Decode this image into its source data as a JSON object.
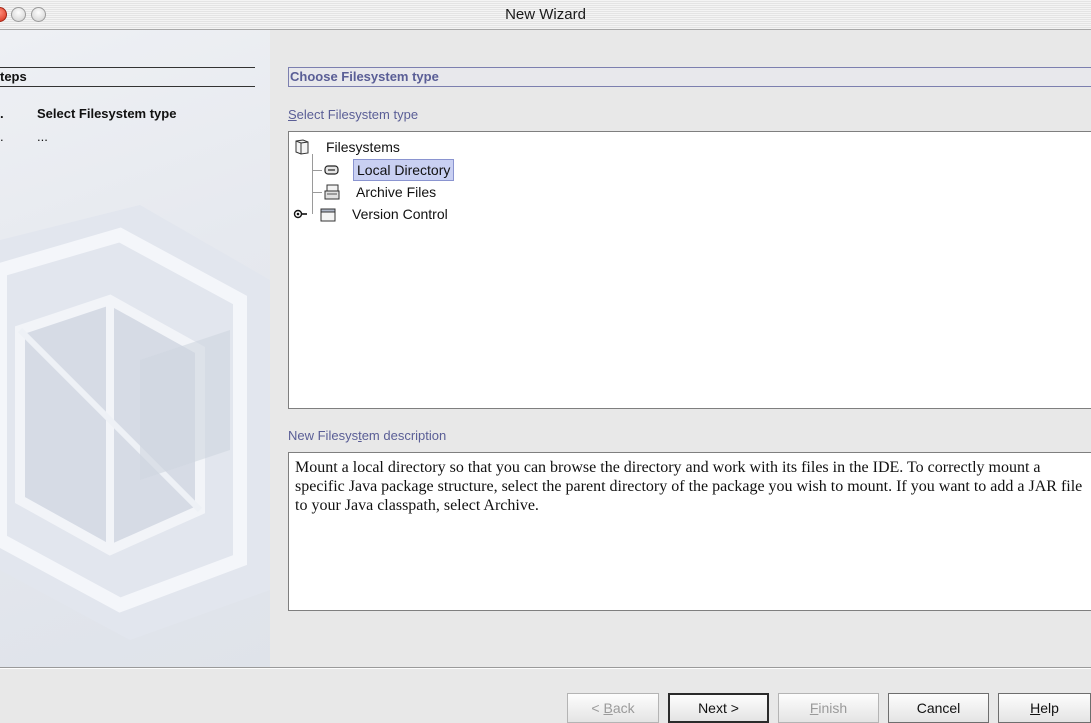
{
  "window": {
    "title": "New Wizard"
  },
  "steps": {
    "heading": "teps",
    "items": [
      {
        "num": ".",
        "label": "Select Filesystem type",
        "current": true
      },
      {
        "num": ".",
        "label": "...",
        "current": false
      }
    ]
  },
  "main": {
    "panel_title": "Choose Filesystem type",
    "tree_label_prefix": "",
    "tree_label_mnemonic": "S",
    "tree_label_rest": "elect Filesystem type",
    "tree": {
      "root": "Filesystems",
      "items": [
        {
          "label": "Local Directory",
          "icon": "drive-icon",
          "selected": true
        },
        {
          "label": "Archive Files",
          "icon": "archive-icon",
          "selected": false
        },
        {
          "label": "Version Control",
          "icon": "folder-icon",
          "selected": false
        }
      ]
    },
    "desc_label_prefix": "New Filesys",
    "desc_label_mnemonic": "t",
    "desc_label_rest": "em description",
    "description": "Mount a local directory so that you can browse the directory and work with its files in the IDE. To correctly mount a specific Java package structure, select the parent directory of the package you wish to mount. If you want to add a JAR file to your Java classpath, select Archive."
  },
  "buttons": {
    "back": {
      "prefix": "< ",
      "mnemonic": "B",
      "rest": "ack"
    },
    "next": "Next >",
    "finish": {
      "prefix": "",
      "mnemonic": "F",
      "rest": "inish"
    },
    "cancel": "Cancel",
    "help": {
      "prefix": "",
      "mnemonic": "H",
      "rest": "elp"
    }
  }
}
